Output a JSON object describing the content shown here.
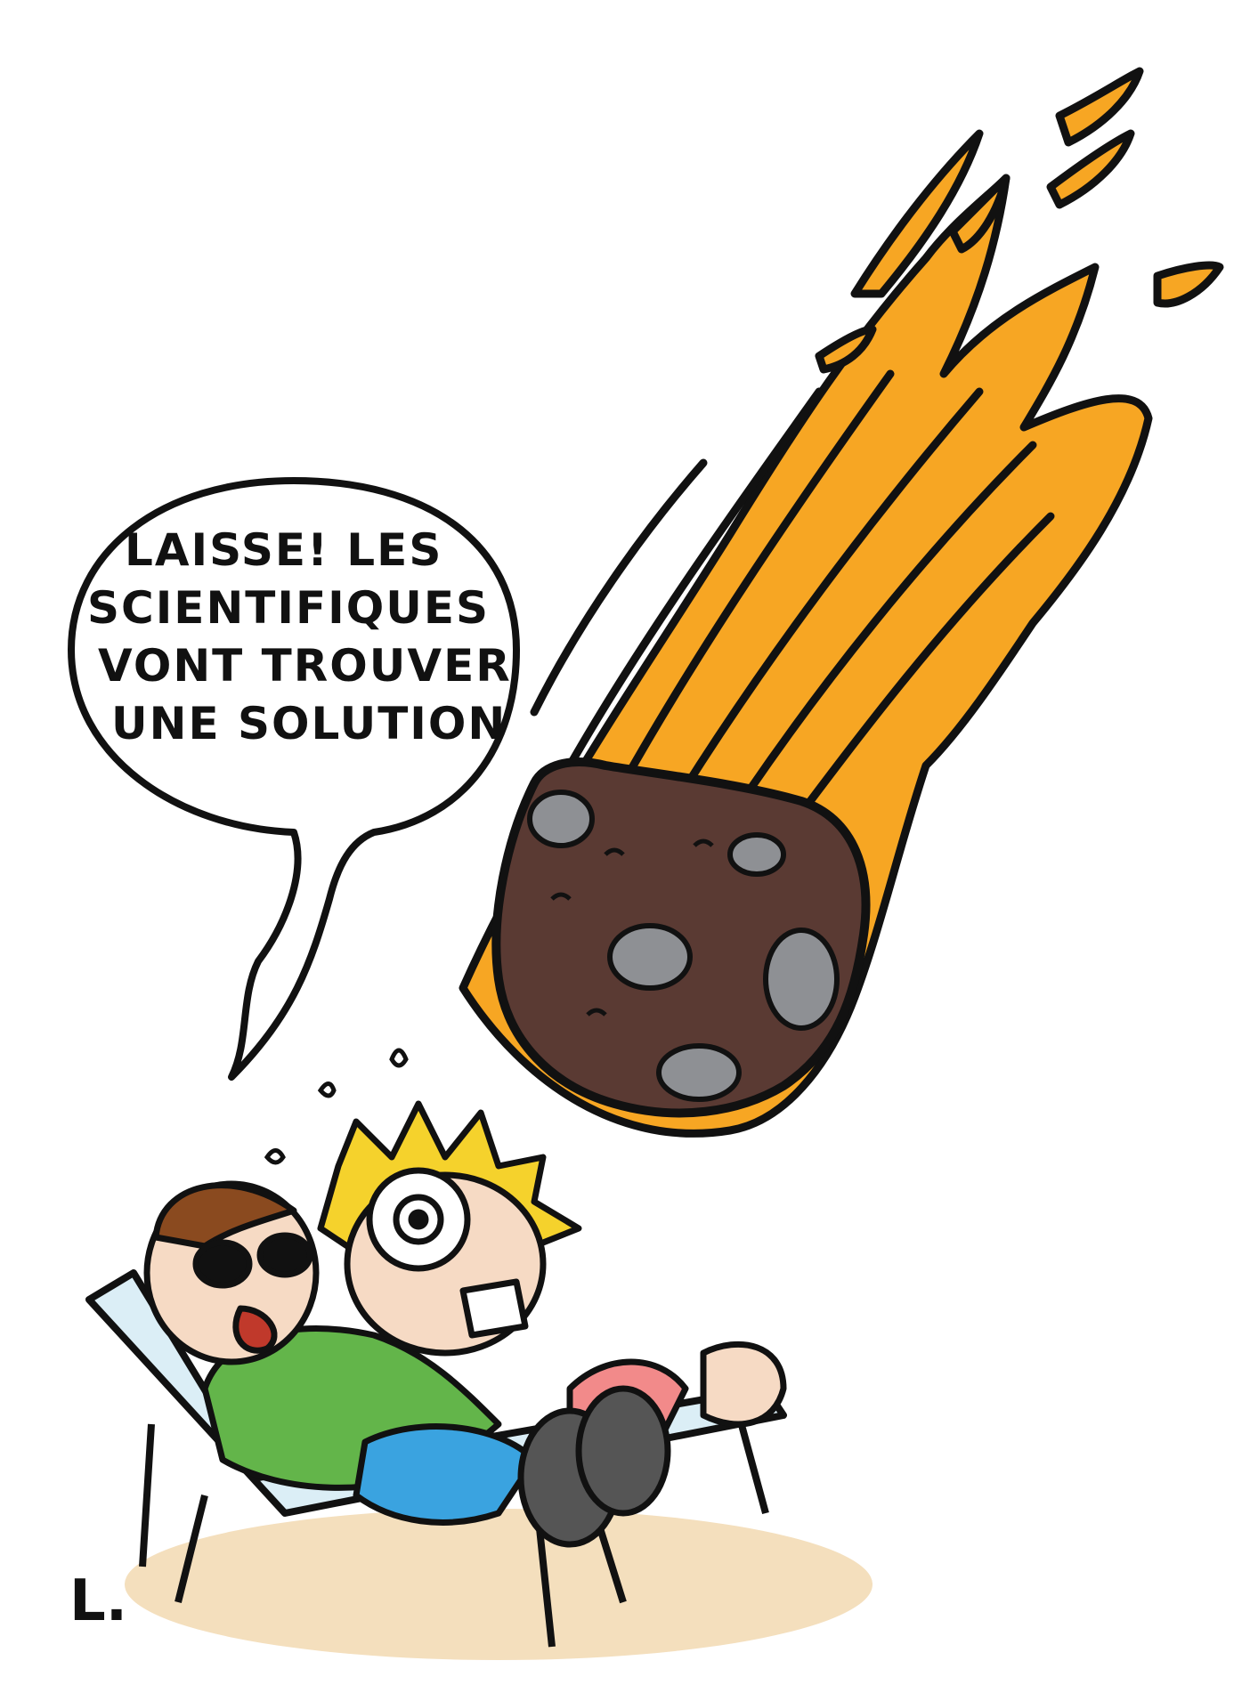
{
  "speech_bubble": {
    "lines": [
      "LAISSE! LES",
      "SCIENTIFIQUES",
      "VONT TROUVER",
      "UNE SOLUTION"
    ]
  },
  "signature": "L.",
  "colors": {
    "flame": "#f7a623",
    "meteor": "#5a3a33",
    "crater": "#8e9094",
    "sand": "#f4dfbd",
    "shirt": "#63b54a",
    "shorts_blue": "#3aa3e0",
    "shorts_pink": "#f28a8a",
    "hair_brown": "#8a4a1f",
    "hair_blond": "#f5d22c",
    "skin": "#f6dac4",
    "chair": "#dbeef6"
  },
  "icons": [
    "meteor-icon",
    "flame-trail-icon",
    "sunglasses-icon"
  ]
}
